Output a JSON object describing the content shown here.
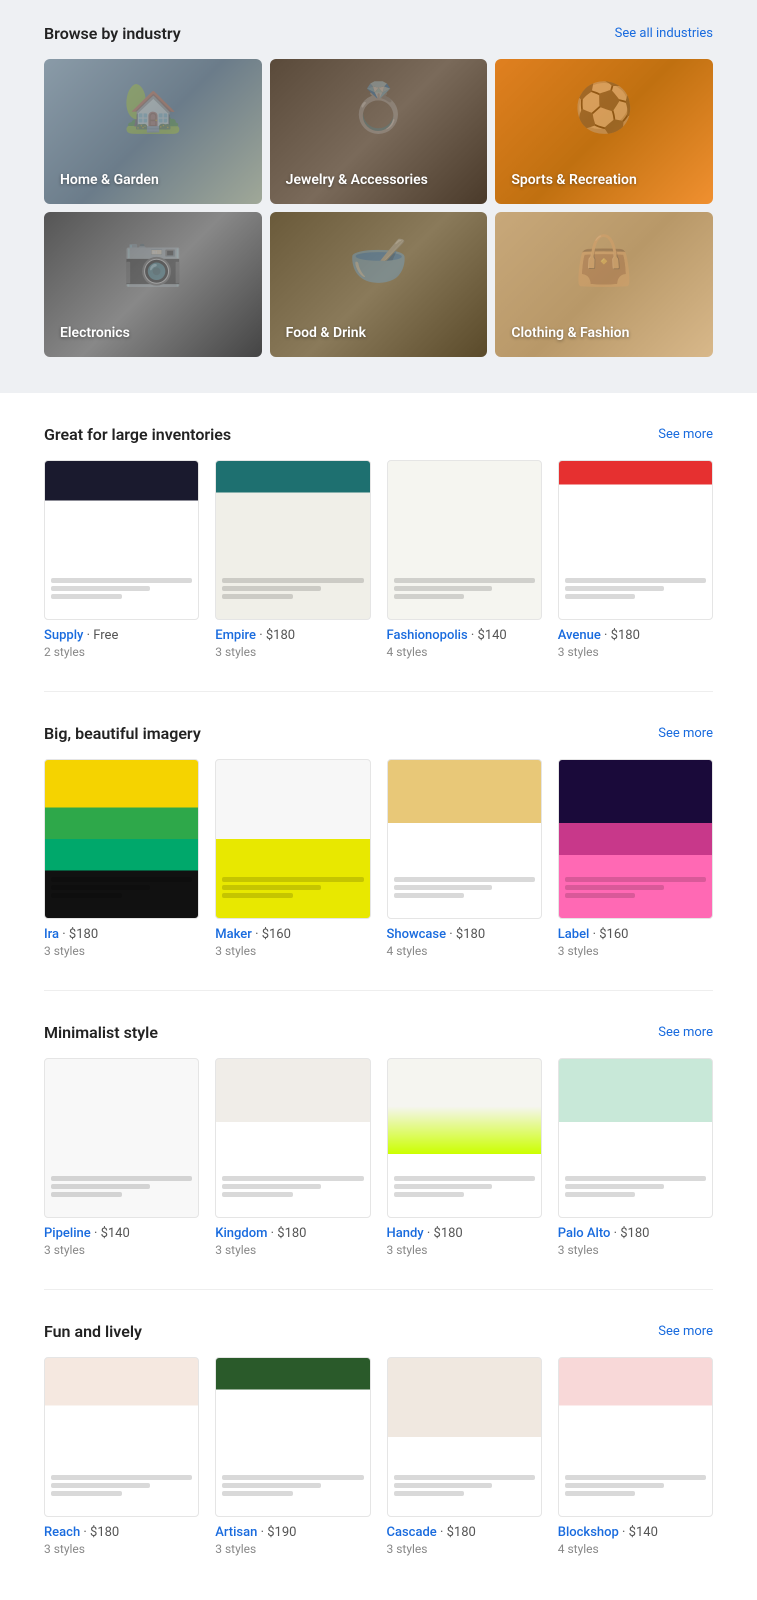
{
  "browse": {
    "title": "Browse by industry",
    "see_all_label": "See all industries",
    "industries": [
      {
        "id": "home-garden",
        "label": "Home & Garden",
        "css_class": "card-home"
      },
      {
        "id": "jewelry",
        "label": "Jewelry & Accessories",
        "css_class": "card-jewelry"
      },
      {
        "id": "sports",
        "label": "Sports & Recreation",
        "css_class": "card-sports"
      },
      {
        "id": "electronics",
        "label": "Electronics",
        "css_class": "card-electronics"
      },
      {
        "id": "food",
        "label": "Food & Drink",
        "css_class": "card-food"
      },
      {
        "id": "clothing",
        "label": "Clothing & Fashion",
        "css_class": "card-clothing"
      }
    ]
  },
  "sections": [
    {
      "id": "large-inventories",
      "title": "Great for large inventories",
      "see_more_label": "See more",
      "themes": [
        {
          "id": "supply",
          "name": "Supply",
          "price": "Free",
          "styles": "2 styles",
          "thumb_class": "t1"
        },
        {
          "id": "empire",
          "name": "Empire",
          "price": "$180",
          "styles": "3 styles",
          "thumb_class": "t2"
        },
        {
          "id": "fashionopolis",
          "name": "Fashionopolis",
          "price": "$140",
          "styles": "4 styles",
          "thumb_class": "t3"
        },
        {
          "id": "avenue",
          "name": "Avenue",
          "price": "$180",
          "styles": "3 styles",
          "thumb_class": "t4"
        }
      ]
    },
    {
      "id": "big-imagery",
      "title": "Big, beautiful imagery",
      "see_more_label": "See more",
      "themes": [
        {
          "id": "ira",
          "name": "Ira",
          "price": "$180",
          "styles": "3 styles",
          "thumb_class": "t5"
        },
        {
          "id": "maker",
          "name": "Maker",
          "price": "$160",
          "styles": "3 styles",
          "thumb_class": "t6"
        },
        {
          "id": "showcase",
          "name": "Showcase",
          "price": "$180",
          "styles": "4 styles",
          "thumb_class": "t7"
        },
        {
          "id": "label",
          "name": "Label",
          "price": "$160",
          "styles": "3 styles",
          "thumb_class": "t8"
        }
      ]
    },
    {
      "id": "minimalist",
      "title": "Minimalist style",
      "see_more_label": "See more",
      "themes": [
        {
          "id": "pipeline",
          "name": "Pipeline",
          "price": "$140",
          "styles": "3 styles",
          "thumb_class": "t9"
        },
        {
          "id": "kingdom",
          "name": "Kingdom",
          "price": "$180",
          "styles": "3 styles",
          "thumb_class": "t10"
        },
        {
          "id": "handy",
          "name": "Handy",
          "price": "$180",
          "styles": "3 styles",
          "thumb_class": "t11"
        },
        {
          "id": "palo-alto",
          "name": "Palo Alto",
          "price": "$180",
          "styles": "3 styles",
          "thumb_class": "t12"
        }
      ]
    },
    {
      "id": "fun-lively",
      "title": "Fun and lively",
      "see_more_label": "See more",
      "themes": [
        {
          "id": "reach",
          "name": "Reach",
          "price": "$180",
          "styles": "3 styles",
          "thumb_class": "t13"
        },
        {
          "id": "artisan",
          "name": "Artisan",
          "price": "$190",
          "styles": "3 styles",
          "thumb_class": "t14"
        },
        {
          "id": "cascade",
          "name": "Cascade",
          "price": "$180",
          "styles": "3 styles",
          "thumb_class": "t15"
        },
        {
          "id": "blockshop",
          "name": "Blockshop",
          "price": "$140",
          "styles": "4 styles",
          "thumb_class": "t16"
        }
      ]
    }
  ]
}
